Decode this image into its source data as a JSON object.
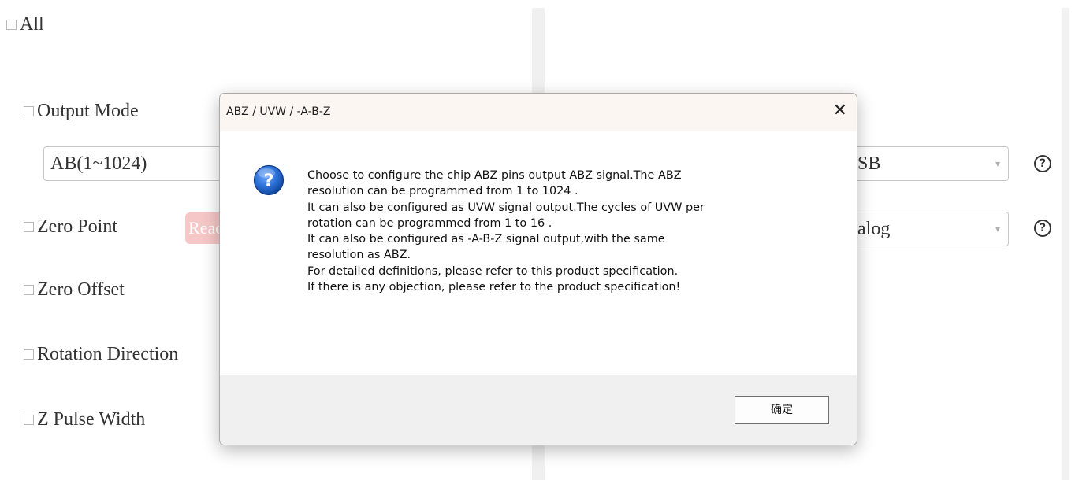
{
  "left_panel": {
    "all_label": "All",
    "output_mode": {
      "label": "Output Mode",
      "value": "AB(1~1024)"
    },
    "zero_point": {
      "label": "Zero Point",
      "badge": "Read"
    },
    "zero_offset": {
      "label": "Zero Offset"
    },
    "rotation_direction": {
      "label": "Rotation Direction"
    },
    "z_pulse_width": {
      "label": "Z Pulse Width"
    }
  },
  "right_panel": {
    "select_1": {
      "value_visible": "SB"
    },
    "select_2": {
      "value_visible": "alog"
    }
  },
  "dialog": {
    "title": "ABZ / UVW / -A-B-Z",
    "close_glyph": "✕",
    "icon": "question-icon",
    "message_lines": [
      "Choose to configure the chip ABZ pins output ABZ signal.The ABZ",
      "resolution can be programmed from 1 to 1024 .",
      "It can also be configured as UVW signal output.The cycles of UVW per",
      "rotation can be programmed from 1 to 16 .",
      "It can also be configured as -A-B-Z signal output,with the same",
      "resolution as ABZ.",
      "For detailed definitions, please refer to this product specification.",
      "If there is any objection, please refer to the product specification!"
    ],
    "ok_label": "确定"
  },
  "colors": {
    "dialog_titlebar": "#fcf6f2",
    "dialog_footer": "#f0f0f0",
    "badge": "#f6c7c7",
    "icon_blue": "#1f5fc4"
  }
}
